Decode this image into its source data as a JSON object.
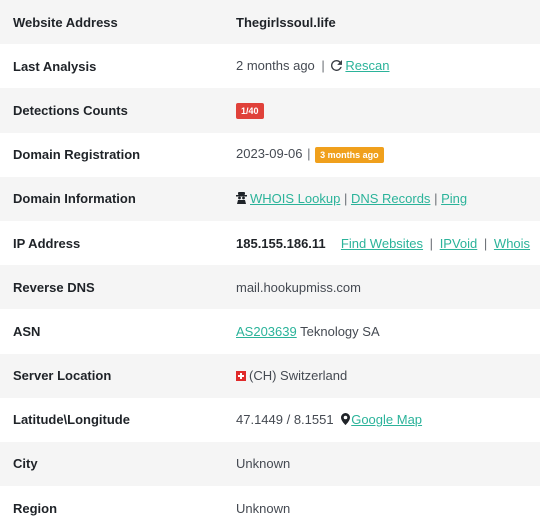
{
  "rows": {
    "website": {
      "label": "Website Address",
      "value": "Thegirlssoul.life"
    },
    "last_analysis": {
      "label": "Last Analysis",
      "value": "2 months ago",
      "separator": "|",
      "rescan": "Rescan"
    },
    "detections": {
      "label": "Detections Counts",
      "badge": "1/40",
      "badge_color": "#e0413a"
    },
    "domain_registration": {
      "label": "Domain Registration",
      "date": "2023-09-06",
      "separator": "|",
      "badge": "3 months ago",
      "badge_color": "#f0a01c"
    },
    "domain_information": {
      "label": "Domain Information",
      "icon": "user-secret-icon",
      "whois": "WHOIS Lookup",
      "sep1": "|",
      "dns": "DNS Records",
      "sep2": "|",
      "ping": "Ping"
    },
    "ip_address": {
      "label": "IP Address",
      "ip": "185.155.186.11",
      "find": "Find Websites",
      "sep1": "|",
      "ipvoid": "IPVoid",
      "sep2": "|",
      "whois": "Whois"
    },
    "reverse_dns": {
      "label": "Reverse DNS",
      "value": "mail.hookupmiss.com"
    },
    "asn": {
      "label": "ASN",
      "asn_link": "AS203639",
      "org": "Teknology SA"
    },
    "server_location": {
      "label": "Server Location",
      "flag": "switzerland-flag-icon",
      "value": "(CH) Switzerland"
    },
    "latlong": {
      "label": "Latitude\\Longitude",
      "value": "47.1449 / 8.1551",
      "icon": "map-marker-icon",
      "map": "Google Map"
    },
    "city": {
      "label": "City",
      "value": "Unknown"
    },
    "region": {
      "label": "Region",
      "value": "Unknown"
    }
  },
  "colors": {
    "link": "#2bb39a",
    "row_alt": "#f5f5f5"
  }
}
